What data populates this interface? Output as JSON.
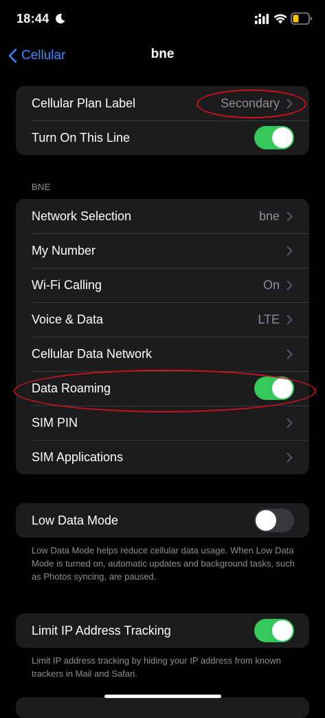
{
  "status_bar": {
    "time": "18:44",
    "focus_icon": "moon-icon",
    "signal_icon": "cellular-signal-icon",
    "wifi_icon": "wifi-icon",
    "battery_icon": "battery-icon",
    "battery_color": "#f7c600"
  },
  "nav": {
    "back_label": "Cellular",
    "title": "bne",
    "accent_color": "#3a8bff"
  },
  "plan_group": {
    "plan_label": {
      "label": "Cellular Plan Label",
      "value": "Secondary"
    },
    "turn_on_line": {
      "label": "Turn On This Line",
      "toggle": "on"
    }
  },
  "bne_section": {
    "header": "BNE",
    "rows": {
      "network_selection": {
        "label": "Network Selection",
        "value": "bne"
      },
      "my_number": {
        "label": "My Number",
        "value": ""
      },
      "wifi_calling": {
        "label": "Wi-Fi Calling",
        "value": "On"
      },
      "voice_data": {
        "label": "Voice & Data",
        "value": "LTE"
      },
      "cellular_data_network": {
        "label": "Cellular Data Network",
        "value": ""
      },
      "data_roaming": {
        "label": "Data Roaming",
        "toggle": "on"
      },
      "sim_pin": {
        "label": "SIM PIN",
        "value": ""
      },
      "sim_applications": {
        "label": "SIM Applications",
        "value": ""
      }
    }
  },
  "low_data": {
    "label": "Low Data Mode",
    "toggle": "off",
    "footer": "Low Data Mode helps reduce cellular data usage. When Low Data Mode is turned on, automatic updates and background tasks, such as Photos syncing, are paused."
  },
  "limit_ip": {
    "label": "Limit IP Address Tracking",
    "toggle": "on",
    "footer": "Limit IP address tracking by hiding your IP address from known trackers in Mail and Safari."
  },
  "colors": {
    "toggle_on": "#34c759",
    "toggle_off": "#39393d",
    "annotation": "#d0121b"
  }
}
